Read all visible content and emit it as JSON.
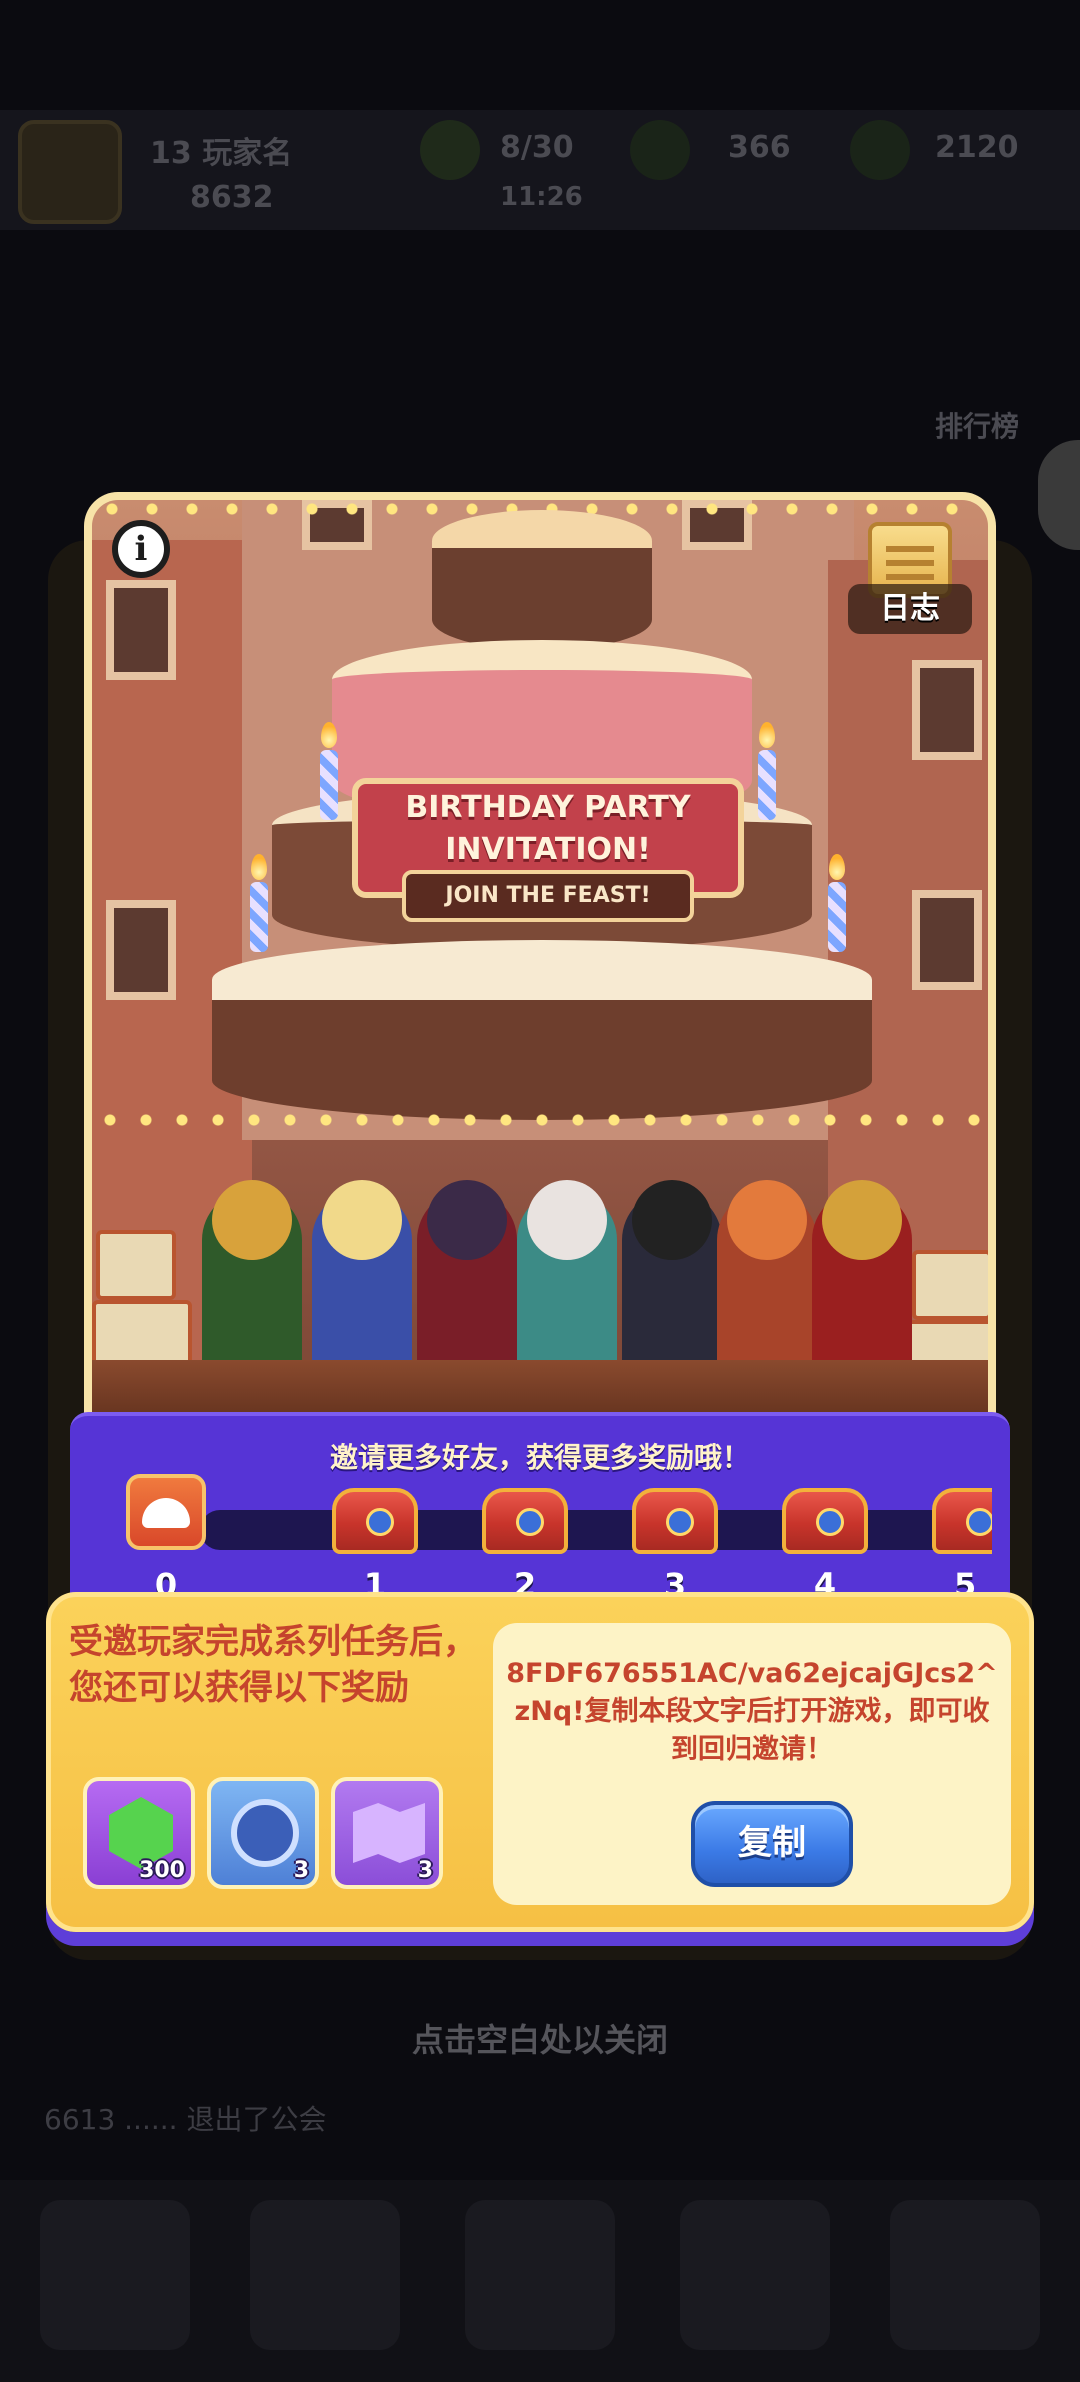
{
  "background": {
    "player_level": "13 玩家名",
    "currency_primary": "8632",
    "stat_a": "8/30",
    "stat_time": "11:26",
    "stat_b": "366",
    "stat_c": "2120",
    "ranking_label": "排行榜",
    "close_hint": "点击空白处以关闭",
    "chat_line": "6613 ...... 退出了公会"
  },
  "banner": {
    "title_line1": "BIRTHDAY PARTY",
    "title_line2": "INVITATION!",
    "subtitle": "JOIN THE FEAST!",
    "info_icon": "i",
    "log_label": "日志"
  },
  "progress": {
    "title": "邀请更多好友，获得更多奖励哦！",
    "milestones": [
      "0",
      "1",
      "2",
      "3",
      "4",
      "5"
    ]
  },
  "reward": {
    "description": "受邀玩家完成系列任务后，您还可以获得以下奖励",
    "items": [
      {
        "icon": "green-gem-icon",
        "count": "300"
      },
      {
        "icon": "shield-badge-icon",
        "count": "3"
      },
      {
        "icon": "map-scroll-icon",
        "count": "3"
      }
    ],
    "invite_code_text": "8FDF676551AC/va62ejcajGJcs2^zNq!复制本段文字后打开游戏，即可收到回归邀请！",
    "copy_label": "复制"
  },
  "colors": {
    "progress_purple": "#5634d6",
    "reward_yellow": "#f6c044",
    "reward_text_red": "#c5442d",
    "copy_blue": "#3b7ae6"
  }
}
